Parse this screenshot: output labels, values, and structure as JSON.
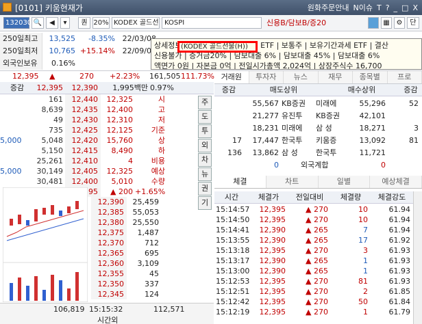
{
  "window": {
    "title": "[0101] 키움현재가",
    "menu": [
      "원화주문안내",
      "N이슈"
    ],
    "controls": [
      "T",
      "?",
      "_",
      "□",
      "X"
    ]
  },
  "toolbar": {
    "code": "132030",
    "btn1": "퀀",
    "btn2": "20%",
    "name": "KODEX 골드선",
    "market": "KOSPI",
    "credit": "신용B/담보B/증20",
    "btn3": "단"
  },
  "info": {
    "rows": [
      {
        "label": "250일최고",
        "v1": "13,525",
        "v2": "-8.35%",
        "v3": "22/03/08"
      },
      {
        "label": "250일최저",
        "v1": "10,765",
        "v2": "+15.14%",
        "v3": "22/09/08"
      },
      {
        "label": "외국인보유",
        "v1": "0.16%",
        "v2": "",
        "v3": ""
      }
    ]
  },
  "overlay": {
    "line1": "상세정보  (KODEX 골드선물(H))   ETF | 보통주 | 보유기간과세 ETF | 결산",
    "line2": "신용불가 | 증거금20% | 담보대출 6% | 담보대출 45% | 담보대출 6%",
    "line3": "액면가 0원 | 자본금 0억 | 전일시가총액 2,024억 | 상장주식수 16,700",
    "highlight": "(KODEX 골드선물(H))"
  },
  "pricebar": {
    "price": "12,395",
    "arrow": "▲",
    "change": "270",
    "rate": "+2.23%",
    "volume": "161,505",
    "ratio": "111.73%"
  },
  "orderbook": {
    "header": {
      "c1": "증감",
      "c2": "12,395",
      "c3": "12,390",
      "c4": "1,995백만",
      "c6": "0.97%"
    },
    "asks": [
      {
        "q": "161",
        "p": "12,440"
      },
      {
        "q": "8,639",
        "p": "12,435"
      },
      {
        "q": "49",
        "p": "12,430"
      },
      {
        "q": "735",
        "p": "12,425"
      },
      {
        "c1": "5,000",
        "q": "5,048",
        "p": "12,420"
      },
      {
        "q": "5,150",
        "p": "12,415"
      },
      {
        "q": "25,261",
        "p": "12,410"
      },
      {
        "c1": "5,000",
        "q": "30,149",
        "p": "12,405"
      },
      {
        "q": "30,481",
        "p": "12,400"
      },
      {
        "q": "1,146",
        "p": "12,395"
      }
    ],
    "askinfo": [
      {
        "v": "12,325",
        "k": "시"
      },
      {
        "v": "12,400",
        "k": "고"
      },
      {
        "v": "12,310",
        "k": "저"
      },
      {
        "v": "12,125",
        "k": "기준"
      },
      {
        "v": "15,760",
        "k": "상"
      },
      {
        "v": "8,490",
        "k": "하"
      },
      {
        "v": "4",
        "k": "비용"
      },
      {
        "v": "12,325",
        "k": "예상"
      },
      {
        "v": "5,010",
        "k": "수량"
      },
      {
        "v": "▲ 200",
        "k": "+1.65%"
      }
    ],
    "bids": [
      {
        "p": "12,390",
        "q": "25,459"
      },
      {
        "p": "12,385",
        "q": "55,053"
      },
      {
        "p": "12,380",
        "q": "25,550"
      },
      {
        "p": "12,375",
        "q": "1,487"
      },
      {
        "p": "12,370",
        "q": "712"
      },
      {
        "p": "12,365",
        "q": "695"
      },
      {
        "p": "12,360",
        "q": "3,109"
      },
      {
        "p": "12,355",
        "q": "45"
      },
      {
        "p": "12,350",
        "q": "337"
      },
      {
        "p": "12,345",
        "q": "124"
      }
    ],
    "side": [
      "주",
      "도",
      "투",
      "외",
      "차",
      "뉴",
      "권",
      "기"
    ],
    "footer": {
      "total_ask": "106,819",
      "time": "15:15:32",
      "label": "시간외",
      "total_bid": "112,571"
    }
  },
  "righttabs": [
    "거래원",
    "투자자",
    "뉴스",
    "재무",
    "종목별",
    "프로"
  ],
  "broker": {
    "header": [
      "증감",
      "매도상위",
      "매수상위",
      "증감"
    ],
    "rows": [
      {
        "l1": "",
        "sq": "55,567",
        "sn": "KB증권",
        "bn": "미래에",
        "bq": "55,296",
        "r": "52"
      },
      {
        "l1": "",
        "sq": "21,277",
        "sn": "유진투",
        "bn": "KB증권",
        "bq": "42,101",
        "r": ""
      },
      {
        "l1": "",
        "sq": "18,231",
        "sn": "미래에",
        "bn": "삼 성",
        "bq": "18,271",
        "r": "3"
      },
      {
        "l1": "17",
        "sq": "17,447",
        "sn": "한국투",
        "bn": "키움증",
        "bq": "13,092",
        "r": "81"
      },
      {
        "l1": "136",
        "sq": "13,862",
        "sn": "삼 성",
        "bn": "한국투",
        "bq": "11,721",
        "r": ""
      }
    ],
    "foreign": {
      "l": "0",
      "label": "외국계합",
      "r": "0"
    }
  },
  "ticktabs": [
    "체결",
    "차트",
    "일별",
    "예상체결"
  ],
  "ticks": {
    "header": [
      "시간",
      "체결가",
      "전일대비",
      "체결량",
      "체결강도"
    ],
    "rows": [
      {
        "t": "15:14:57",
        "p": "12,395",
        "d": "270",
        "v": "10",
        "s": "61.94"
      },
      {
        "t": "15:14:50",
        "p": "12,395",
        "d": "270",
        "v": "10",
        "s": "61.94"
      },
      {
        "t": "15:14:41",
        "p": "12,390",
        "d": "265",
        "v": "7",
        "s": "61.94"
      },
      {
        "t": "15:13:55",
        "p": "12,390",
        "d": "265",
        "v": "17",
        "s": "61.92"
      },
      {
        "t": "15:13:18",
        "p": "12,395",
        "d": "270",
        "v": "3",
        "s": "61.93"
      },
      {
        "t": "15:13:17",
        "p": "12,390",
        "d": "265",
        "v": "1",
        "s": "61.93"
      },
      {
        "t": "15:13:00",
        "p": "12,390",
        "d": "265",
        "v": "1",
        "s": "61.93"
      },
      {
        "t": "15:12:53",
        "p": "12,395",
        "d": "270",
        "v": "81",
        "s": "61.93"
      },
      {
        "t": "15:12:51",
        "p": "12,395",
        "d": "270",
        "v": "2",
        "s": "61.85"
      },
      {
        "t": "15:12:42",
        "p": "12,395",
        "d": "270",
        "v": "50",
        "s": "61.84"
      },
      {
        "t": "15:12:19",
        "p": "12,395",
        "d": "270",
        "v": "1",
        "s": "61.79"
      }
    ]
  }
}
